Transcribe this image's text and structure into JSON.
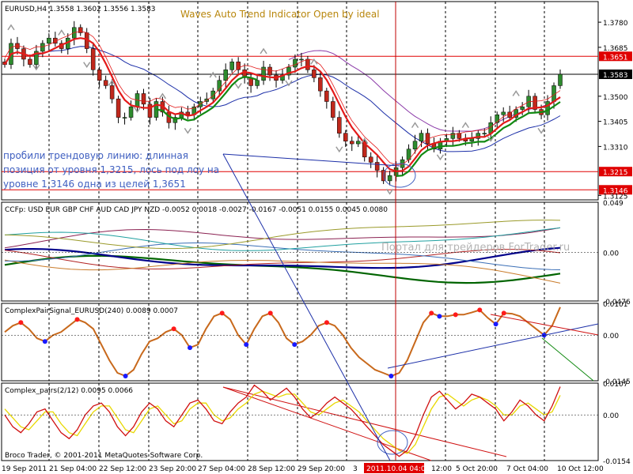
{
  "header": {
    "symbol_text": "EURUSD,H4  1.3558 1.3602 1.3556 1.3583",
    "indicator_title": "Waves Auto Trend Indicator Open by ideal"
  },
  "annotation_text": [
    "пробили трендовую линию: длинная",
    "позиция от уровня 1,3215, лось под лоу на",
    "уровне 1,3146 одна из целей 1,3651"
  ],
  "watermark": "Портал для трейдеров ForTrader.ru",
  "copyright": "Broco Trader, © 2001-2011 MetaQuotes Software Corp.",
  "x_axis": {
    "labels": [
      "19 Sep 2011",
      "21 Sep 04:00",
      "22 Sep 12:00",
      "23 Sep 20:00",
      "27 Sep 04:00",
      "28 Sep 12:00",
      "29 Sep 20:00",
      "3",
      "2011.10.04 04:00",
      "12:00",
      "5 Oct 20:00",
      "7 Oct 04:00",
      "10 Oct 12:00"
    ],
    "highlighted": "2011.10.04 04:00"
  },
  "colors": {
    "background": "#ffffff",
    "bull_candle": "#2e8b2e",
    "bear_candle": "#c0281c",
    "level_line": "#e00000",
    "fast_ma": "#e31a1a",
    "slow_ma": "#1c2fa8",
    "trend_green": "#128a12",
    "purple_ma": "#8b3aa8",
    "signal_line": "#c8691c",
    "dot_red": "#ff1a1a",
    "dot_blue": "#1a1aff",
    "pairs_red": "#d01010",
    "pairs_yellow": "#e8d800"
  },
  "chart_data": [
    {
      "type": "candlestick",
      "name": "EURUSD,H4",
      "ylim": [
        1.3108,
        1.3858
      ],
      "y_ticks": [
        "1.3780",
        "1.3685",
        "1.3500",
        "1.3405",
        "1.3310",
        "1.3125"
      ],
      "levels": [
        {
          "label": "1.3651",
          "value": 1.3651,
          "color": "#e00000"
        },
        {
          "label": "1.3583",
          "value": 1.3583,
          "color": "#000000"
        },
        {
          "label": "1.3215",
          "value": 1.3215,
          "color": "#e00000"
        },
        {
          "label": "1.3146",
          "value": 1.3146,
          "color": "#e00000"
        }
      ],
      "approx_closes": [
        1.362,
        1.37,
        1.368,
        1.364,
        1.362,
        1.367,
        1.37,
        1.372,
        1.37,
        1.368,
        1.372,
        1.376,
        1.374,
        1.368,
        1.36,
        1.356,
        1.354,
        1.349,
        1.342,
        1.342,
        1.346,
        1.351,
        1.347,
        1.342,
        1.348,
        1.344,
        1.34,
        1.342,
        1.344,
        1.343,
        1.346,
        1.348,
        1.349,
        1.352,
        1.356,
        1.36,
        1.363,
        1.36,
        1.357,
        1.354,
        1.356,
        1.361,
        1.358,
        1.356,
        1.358,
        1.361,
        1.364,
        1.364,
        1.36,
        1.357,
        1.352,
        1.348,
        1.342,
        1.336,
        1.333,
        1.332,
        1.333,
        1.327,
        1.325,
        1.322,
        1.318,
        1.32,
        1.323,
        1.326,
        1.33,
        1.333,
        1.336,
        1.332,
        1.33,
        1.333,
        1.334,
        1.336,
        1.334,
        1.333,
        1.334,
        1.336,
        1.336,
        1.34,
        1.343,
        1.344,
        1.342,
        1.345,
        1.346,
        1.35,
        1.345,
        1.343,
        1.348,
        1.354,
        1.3583
      ]
    },
    {
      "type": "line",
      "name": "CCFp",
      "legend_text": "CCFp: USD EUR GBP CHF AUD CAD JPY NZD -0.0052 0.0018 -0.0027 -0.0167 -0.0051 0.0155 0.0045 0.0080",
      "ylim": [
        -0.0476,
        0.049
      ],
      "y_ticks": [
        "0.049",
        "0.00",
        "-0.0476"
      ],
      "series": [
        {
          "name": "USD",
          "value": -0.0052,
          "color": "#006400"
        },
        {
          "name": "EUR",
          "value": 0.0018,
          "color": "#00008b"
        },
        {
          "name": "GBP",
          "value": -0.0027,
          "color": "#b22222"
        },
        {
          "name": "CHF",
          "value": -0.0167,
          "color": "#c97b2a"
        },
        {
          "name": "AUD",
          "value": -0.0051,
          "color": "#3b6fb6"
        },
        {
          "name": "CAD",
          "value": 0.0155,
          "color": "#8b2252"
        },
        {
          "name": "JPY",
          "value": 0.0045,
          "color": "#20a0a0"
        },
        {
          "name": "NZD",
          "value": 0.008,
          "color": "#9a9a2a"
        }
      ]
    },
    {
      "type": "line",
      "name": "ComplexPairSignal_EURUSD(240)",
      "legend_text": "ComplexPairSignal_EURUSD(240) 0.0089 0.0007",
      "ylim": [
        -0.0145,
        0.0101
      ],
      "y_ticks": [
        "0.0101",
        "0.00",
        "-0.0145"
      ],
      "values": [
        0.001,
        0.003,
        0.004,
        0.002,
        -0.001,
        -0.002,
        0.0,
        0.001,
        0.003,
        0.005,
        0.004,
        0.002,
        -0.003,
        -0.008,
        -0.012,
        -0.013,
        -0.011,
        -0.006,
        -0.002,
        -0.001,
        0.001,
        0.002,
        0.0,
        -0.004,
        -0.003,
        0.002,
        0.006,
        0.007,
        0.005,
        0.0,
        -0.003,
        0.002,
        0.006,
        0.007,
        0.004,
        -0.001,
        -0.003,
        -0.002,
        0.0,
        0.003,
        0.004,
        0.003,
        0.0,
        -0.004,
        -0.007,
        -0.009,
        -0.011,
        -0.012,
        -0.013,
        -0.012,
        -0.008,
        -0.002,
        0.004,
        0.007,
        0.006,
        0.006,
        0.0065,
        0.0065,
        0.0072,
        0.008,
        0.0055,
        0.0035,
        0.007,
        0.0068,
        0.006,
        0.004,
        0.002,
        0.0,
        0.003,
        0.0089
      ]
    },
    {
      "type": "line",
      "name": "Complex_pairs(2/12)",
      "legend_text": "Complex_pairs(2/12) 0.0095 0.0066",
      "ylim": [
        -0.0154,
        0.0107
      ],
      "y_ticks": [
        "0.0107",
        "0.00",
        "-0.0154"
      ],
      "series_red": [
        0.0,
        -0.004,
        -0.006,
        -0.003,
        0.001,
        0.002,
        -0.002,
        -0.006,
        -0.008,
        -0.005,
        0.0,
        0.003,
        0.004,
        0.001,
        -0.004,
        -0.007,
        -0.004,
        0.001,
        0.004,
        0.002,
        -0.002,
        -0.004,
        0.0,
        0.004,
        0.005,
        0.002,
        -0.002,
        -0.003,
        0.001,
        0.004,
        0.006,
        0.01,
        0.008,
        0.005,
        0.007,
        0.009,
        0.006,
        0.002,
        -0.001,
        0.001,
        0.004,
        0.006,
        0.004,
        0.002,
        -0.001,
        -0.004,
        -0.007,
        -0.01,
        -0.012,
        -0.014,
        -0.012,
        -0.007,
        0.0,
        0.006,
        0.008,
        0.005,
        0.002,
        0.004,
        0.007,
        0.006,
        0.004,
        0.002,
        -0.002,
        0.001,
        0.005,
        0.003,
        0.0,
        -0.002,
        0.003,
        0.0095
      ],
      "series_yellow": [
        0.002,
        -0.001,
        -0.004,
        -0.005,
        -0.002,
        0.001,
        0.001,
        -0.003,
        -0.006,
        -0.007,
        -0.003,
        0.001,
        0.003,
        0.003,
        -0.001,
        -0.005,
        -0.006,
        -0.002,
        0.002,
        0.003,
        0.0,
        -0.003,
        -0.002,
        0.002,
        0.004,
        0.004,
        0.0,
        -0.002,
        -0.001,
        0.002,
        0.004,
        0.007,
        0.008,
        0.007,
        0.006,
        0.007,
        0.007,
        0.004,
        0.001,
        0.0,
        0.002,
        0.004,
        0.005,
        0.003,
        0.001,
        -0.002,
        -0.005,
        -0.008,
        -0.01,
        -0.012,
        -0.013,
        -0.01,
        -0.004,
        0.002,
        0.006,
        0.007,
        0.005,
        0.003,
        0.005,
        0.006,
        0.005,
        0.003,
        0.0,
        0.0,
        0.003,
        0.004,
        0.002,
        0.0,
        0.001,
        0.0066
      ]
    }
  ]
}
